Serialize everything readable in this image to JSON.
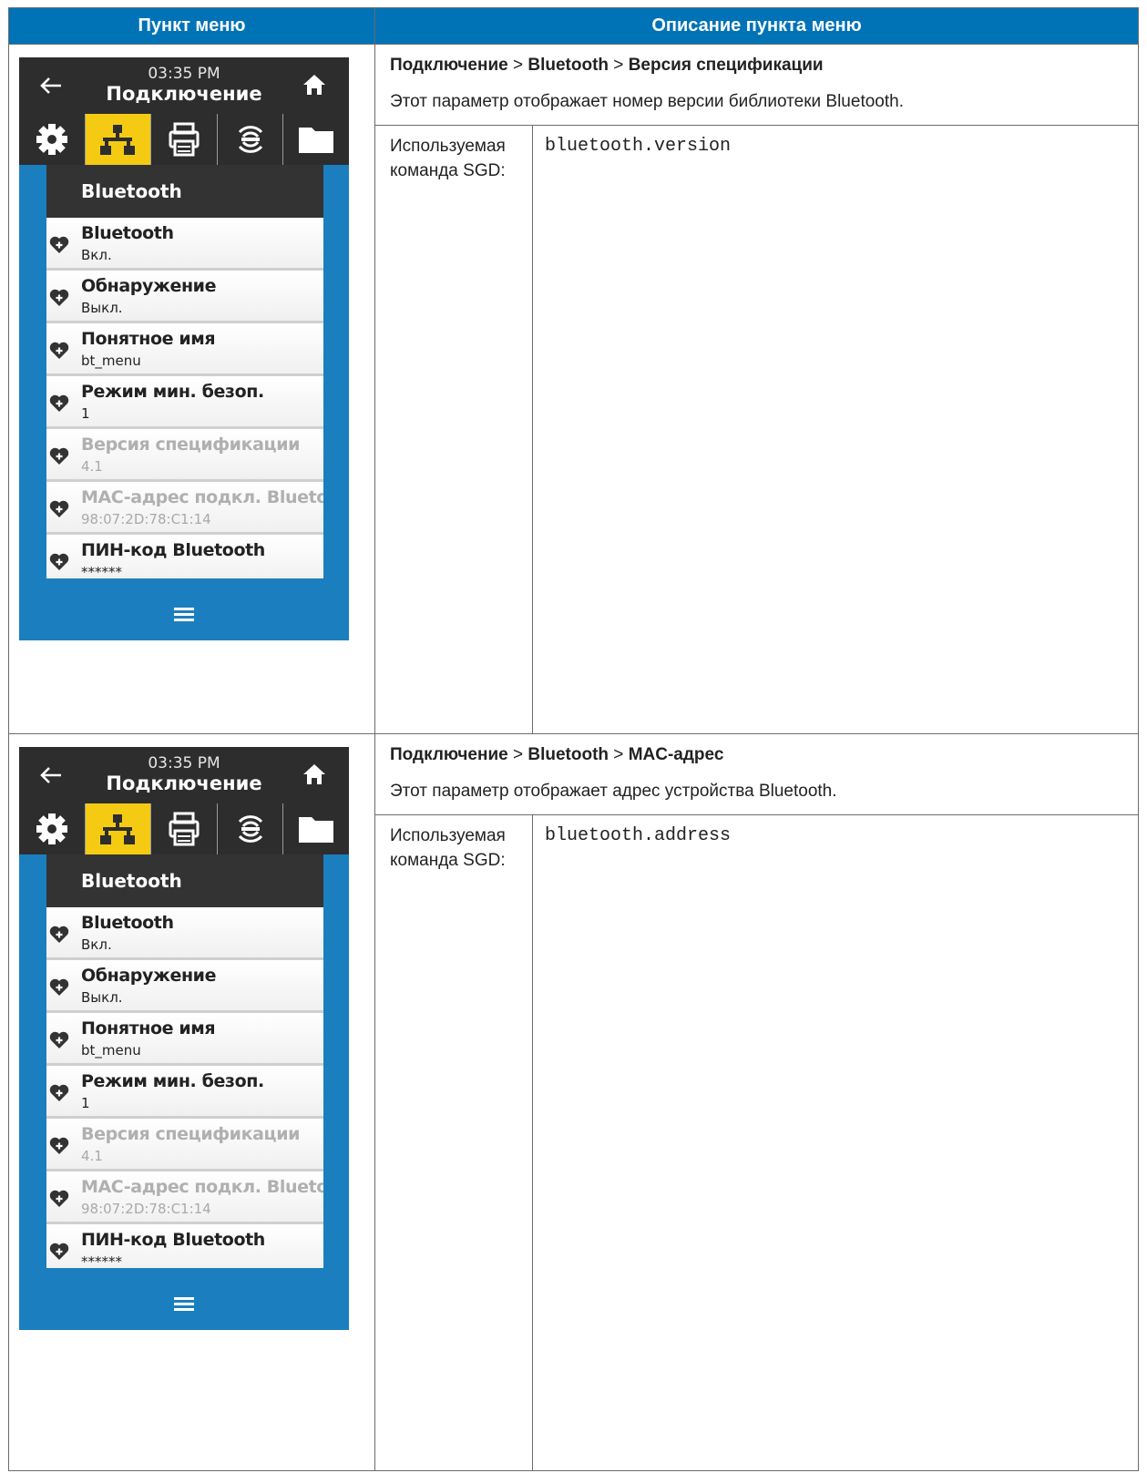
{
  "table": {
    "header_item": "Пункт меню",
    "header_desc": "Описание пункта меню"
  },
  "rows": [
    {
      "screen": {
        "time": "03:35 PM",
        "title": "Подключение",
        "panel_title": "Bluetooth",
        "items": [
          {
            "title": "Bluetooth",
            "value": "Вкл.",
            "dim": false
          },
          {
            "title": "Обнаружение",
            "value": "Выкл.",
            "dim": false
          },
          {
            "title": "Понятное имя",
            "value": "bt_menu",
            "dim": false
          },
          {
            "title": "Режим мин. безоп.",
            "value": "1",
            "dim": false
          },
          {
            "title": "Версия спецификации",
            "value": "4.1",
            "dim": true
          },
          {
            "title": "MAC-адрес подкл. Bluetooth",
            "value": "98:07:2D:78:C1:14",
            "dim": true
          },
          {
            "title": "ПИН-код Bluetooth",
            "value": "******",
            "dim": false
          }
        ]
      },
      "path": [
        "Подключение",
        " > ",
        "Bluetooth",
        " > ",
        "Версия спецификации"
      ],
      "description": "Этот параметр отображает номер версии библиотеки Bluetooth.",
      "sgd_label": "Используемая команда SGD:",
      "sgd_command": "bluetooth.version"
    },
    {
      "screen": {
        "time": "03:35 PM",
        "title": "Подключение",
        "panel_title": "Bluetooth",
        "items": [
          {
            "title": "Bluetooth",
            "value": "Вкл.",
            "dim": false
          },
          {
            "title": "Обнаружение",
            "value": "Выкл.",
            "dim": false
          },
          {
            "title": "Понятное имя",
            "value": "bt_menu",
            "dim": false
          },
          {
            "title": "Режим мин. безоп.",
            "value": "1",
            "dim": false
          },
          {
            "title": "Версия спецификации",
            "value": "4.1",
            "dim": true
          },
          {
            "title": "MAC-адрес подкл. Bluetooth",
            "value": "98:07:2D:78:C1:14",
            "dim": true
          },
          {
            "title": "ПИН-код Bluetooth",
            "value": "******",
            "dim": false
          }
        ]
      },
      "path": [
        "Подключение",
        " > ",
        "Bluetooth",
        " > ",
        "MAC-адрес"
      ],
      "description": "Этот параметр отображает адрес устройства Bluetooth.",
      "sgd_label": "Используемая команда SGD:",
      "sgd_command": "bluetooth.address"
    }
  ],
  "colors": {
    "header_blue": "#0073b7",
    "screen_blue": "#1b7fbf",
    "active_tab": "#f4cb12",
    "dark_bar": "#2d2d2d"
  },
  "icons": {
    "top": [
      "arrow-left-icon",
      "home-icon"
    ],
    "tabs": [
      "gear-icon",
      "network-icon",
      "printer-icon",
      "rfid-icon",
      "folder-icon"
    ],
    "item": "heart-plus-icon",
    "bottom": "hamburger-menu-icon"
  }
}
